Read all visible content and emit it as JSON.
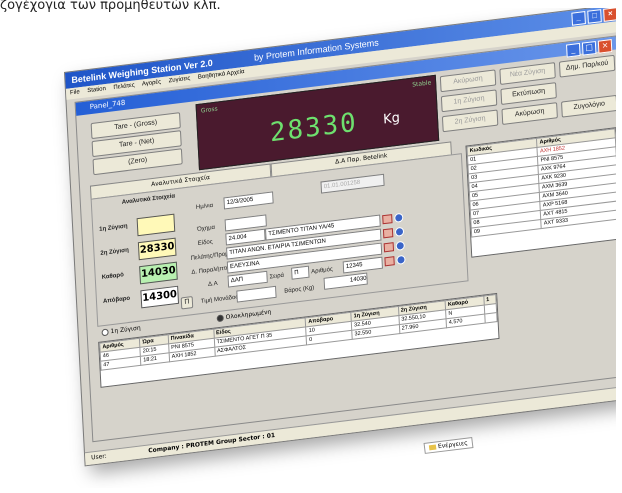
{
  "caption": "ζογέχογια των προμηθευτών κλπ.",
  "window": {
    "title": "Betelink Weighing Station Ver 2.0",
    "subtitle": "by Protem Information Systems",
    "menu": [
      "File",
      "Station",
      "Πελάτες",
      "Αγορές",
      "Ζυγίσεις",
      "Βοηθητικά Αρχεία"
    ]
  },
  "panel": {
    "title": "Panel_748",
    "buttons": {
      "tare_gross": "Tare - (Gross)",
      "tare_net": "Tare - (Net)",
      "zero": "(Zero)",
      "cancel": "Ακύρωση",
      "new_weigh": "Νέα Ζύγιση",
      "print_slip": "Δημ. Παρ/κού",
      "first_weigh": "1η Ζύγιση",
      "print": "Εκτύπωση",
      "second_weigh": "2η Ζύγιση",
      "cancel2": "Ακύρωση",
      "scale_log": "Ζυγολόγιο",
      "save_small": "Π"
    },
    "display": {
      "label": "Gross",
      "status": "Stable",
      "value": "28330",
      "unit": "Kg"
    },
    "tabs": [
      "Αναλυτικά Στοιχεία",
      "Δ.Α Παρ. Betelink"
    ],
    "section_title": "Αναλυτικά Στοιχεία",
    "weights": {
      "first_label": "1η Ζύγιση",
      "first_value": "",
      "second_label": "2η Ζύγιση",
      "second_value": "28330",
      "net_label": "Καθαρό",
      "net_value": "14030",
      "tare_label": "Απόβαρο",
      "tare_value": "14300"
    },
    "form": {
      "date_label": "Ημ/νια",
      "date_value": "12/3/2005",
      "code_value": "01.01.001258",
      "oxima_label": "Όχημα",
      "oxima_value": "",
      "eidos_label": "Είδος",
      "eidos_code": "24.004",
      "eidos_name": "ΤΣΙΜΕΝΤΟ ΤΙΤΑΝ ΥΑ/45",
      "client_label": "Πελάτης/Προμ.",
      "client_value": "ΤΙΤΑΝ ΑΝΩΝ. ΕΤΑΙΡΙΑ ΤΣΙΜΕΝΤΩΝ",
      "dest_label": "Δ. Παραλήπτης",
      "dest_value": "ΕΛΕΥΣΙΝΑ",
      "da_label": "Δ.Α",
      "da_value": "ΔΑΠ",
      "series_label": "Σειρά",
      "series_value": "Π",
      "number_label": "Αριθμός",
      "number_value": "12345",
      "unit_price_label": "Τιμή Μονάδος",
      "weight_kg_label": "Βάρος (Kg)",
      "weight_kg_value": "14030"
    },
    "vehicles": {
      "headers": [
        "Κωδικός",
        "Αριθμός"
      ],
      "rows": [
        [
          "01",
          "ΑΧΗ 1852"
        ],
        [
          "02",
          "ΡΝΙ 8575"
        ],
        [
          "03",
          "ΑΧΚ 9764"
        ],
        [
          "04",
          "ΑΧΚ 9230"
        ],
        [
          "05",
          "ΑΧΜ 3639"
        ],
        [
          "06",
          "ΑΧΜ 3640"
        ],
        [
          "07",
          "ΑΧΡ 5168"
        ],
        [
          "08",
          "ΑΧΤ 4815"
        ],
        [
          "09",
          "ΑΧΤ 9333"
        ]
      ]
    },
    "radios": [
      "1η Ζύγιση",
      "Ολοκληρωμένη"
    ],
    "log": {
      "headers": [
        "Αριθμός",
        "Ώρα",
        "Πινακίδα",
        "Είδος",
        "Απόβαρο",
        "1η Ζύγιση",
        "2η Ζύγιση",
        "Καθαρό",
        "1"
      ],
      "rows": [
        [
          "46",
          "20:15",
          "ΡΝΙ 8575",
          "ΤΣΙΜΕΝΤΟ ΑΓΕΤ Π 35",
          "10",
          "32.540",
          "32.550,10",
          "N"
        ],
        [
          "47",
          "18:21",
          "ΑΧΗ 1852",
          "ΑΣΦΑΛΤΟΣ",
          "0",
          "32.550",
          "27.960",
          "4.570"
        ]
      ]
    },
    "status": {
      "user_label": "User:",
      "company_text": "Company : PROTEM Group  Sector : 01"
    }
  },
  "taskbar_item": "Ενέργειες"
}
